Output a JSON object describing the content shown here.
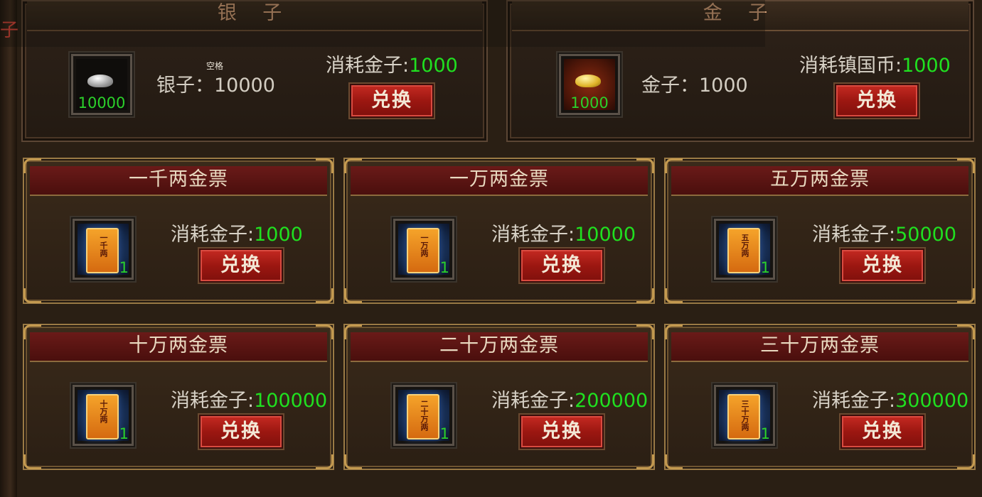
{
  "side_label": "子",
  "silver_panel": {
    "title": "银 子",
    "item_qty": "10000",
    "hint": "空格",
    "amount_label": "银子：",
    "amount_value": "10000",
    "cost_label": "消耗金子:",
    "cost_value": "1000",
    "button": "兑换",
    "icon": "silver-ingot-icon"
  },
  "gold_panel": {
    "title": "金 子",
    "item_qty": "1000",
    "amount_label": "金子：",
    "amount_value": "1000",
    "cost_label": "消耗镇国币:",
    "cost_value": "1000",
    "button": "兑换",
    "icon": "gold-ingot-icon"
  },
  "tickets": [
    {
      "title": "一千两金票",
      "card_text": "一千两",
      "qty": "1",
      "cost_label": "消耗金子:",
      "cost_value": "1000",
      "button": "兑换"
    },
    {
      "title": "一万两金票",
      "card_text": "一万两",
      "qty": "1",
      "cost_label": "消耗金子:",
      "cost_value": "10000",
      "button": "兑换"
    },
    {
      "title": "五万两金票",
      "card_text": "五万两",
      "qty": "1",
      "cost_label": "消耗金子:",
      "cost_value": "50000",
      "button": "兑换"
    },
    {
      "title": "十万两金票",
      "card_text": "十万两",
      "qty": "1",
      "cost_label": "消耗金子:",
      "cost_value": "100000",
      "button": "兑换"
    },
    {
      "title": "二十万两金票",
      "card_text": "二十万两",
      "qty": "1",
      "cost_label": "消耗金子:",
      "cost_value": "200000",
      "button": "兑换"
    },
    {
      "title": "三十万两金票",
      "card_text": "三十万两",
      "qty": "1",
      "cost_label": "消耗金子:",
      "cost_value": "300000",
      "button": "兑换"
    }
  ],
  "colors": {
    "cost_value": "#20e020",
    "qty": "#2bd12b",
    "button_red": "#9c1711",
    "panel_border_gold": "#9a7a45"
  }
}
